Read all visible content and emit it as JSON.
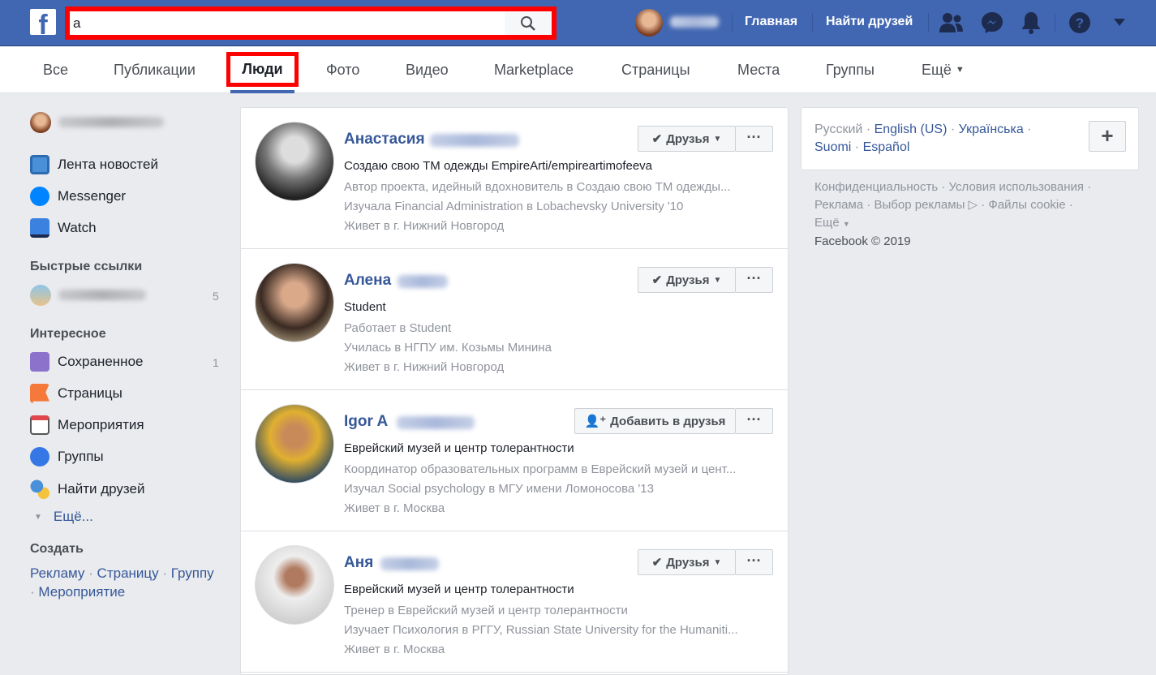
{
  "topbar": {
    "search_value": "a",
    "home": "Главная",
    "find_friends": "Найти друзей",
    "brand": "#4267b2",
    "icons": [
      "facebook-logo",
      "search-icon",
      "friends-icon",
      "messenger-icon",
      "bell-icon",
      "help-icon",
      "caret-down-icon"
    ]
  },
  "tabs": [
    {
      "label": "Все"
    },
    {
      "label": "Публикации"
    },
    {
      "label": "Люди",
      "active": true
    },
    {
      "label": "Фото"
    },
    {
      "label": "Видео"
    },
    {
      "label": "Marketplace"
    },
    {
      "label": "Страницы"
    },
    {
      "label": "Места"
    },
    {
      "label": "Группы"
    },
    {
      "label": "Ещё"
    }
  ],
  "sidebar": {
    "items": [
      {
        "label": "Лента новостей",
        "icon": "news-feed-icon"
      },
      {
        "label": "Messenger",
        "icon": "messenger-icon"
      },
      {
        "label": "Watch",
        "icon": "watch-icon"
      }
    ],
    "quick_links_title": "Быстрые ссылки",
    "quick_link_count": "5",
    "explore_title": "Интересное",
    "explore": [
      {
        "label": "Сохраненное",
        "count": "1",
        "icon": "saved-icon"
      },
      {
        "label": "Страницы",
        "icon": "flag-icon"
      },
      {
        "label": "Мероприятия",
        "icon": "calendar-icon"
      },
      {
        "label": "Группы",
        "icon": "groups-icon"
      },
      {
        "label": "Найти друзей",
        "icon": "find-friends-icon"
      }
    ],
    "more": "Ещё...",
    "create_title": "Создать",
    "create": [
      "Рекламу",
      "Страницу",
      "Группу",
      "Мероприятие"
    ]
  },
  "results": [
    {
      "name": "Анастасия",
      "line1": "Создаю свою ТМ одежды EmpireArti/empireartimofeeva",
      "line2": "Автор проекта, идейный вдохновитель в Создаю свою ТМ одежды...",
      "line3": "Изучала Financial Administration в Lobachevsky University '10",
      "line4": "Живет в г. Нижний Новгород",
      "button": "Друзья",
      "friend": true
    },
    {
      "name": "Алена",
      "line1": "Student",
      "line2": "Работает в Student",
      "line3": "Училась в НГПУ им. Козьмы Минина",
      "line4": "Живет в г. Нижний Новгород",
      "button": "Друзья",
      "friend": true
    },
    {
      "name": "Igor A",
      "line1": "Еврейский музей и центр толерантности",
      "line2": "Координатор образовательных программ в Еврейский музей и цент...",
      "line3": "Изучал Social psychology в МГУ имени Ломоносова '13",
      "line4": "Живет в г. Москва",
      "button": "Добавить в друзья",
      "friend": false
    },
    {
      "name": "Аня",
      "line1": "Еврейский музей и центр толерантности",
      "line2": "Тренер в Еврейский музей и центр толерантности",
      "line3": "Изучает Психология в РГГУ, Russian State University for the Humaniti...",
      "line4": "Живет в г. Москва",
      "button": "Друзья",
      "friend": true
    }
  ],
  "more_label": "···",
  "right": {
    "lang_current": "Русский",
    "langs": [
      "English (US)",
      "Українська",
      "Suomi",
      "Español"
    ],
    "add": "+",
    "footer": [
      "Конфиденциальность",
      "Условия использования",
      "Реклама",
      "Выбор рекламы",
      "Файлы cookie",
      "Ещё"
    ],
    "copyright": "Facebook © 2019"
  }
}
